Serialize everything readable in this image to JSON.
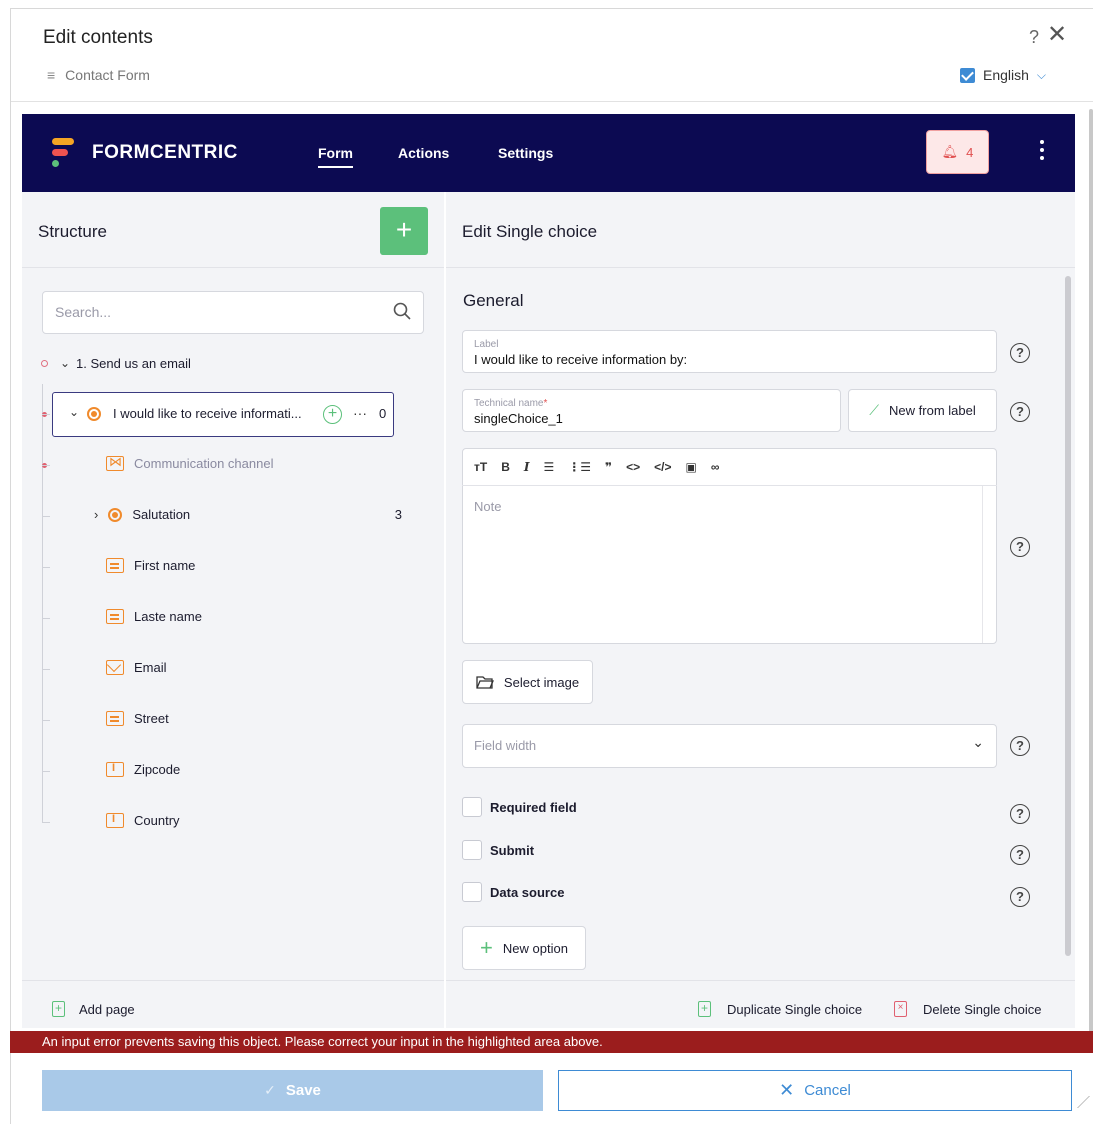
{
  "dialog": {
    "title": "Edit contents",
    "help_label": "?",
    "subtitle": "Contact Form",
    "language": "English"
  },
  "nav": {
    "brand": "FORMCENTRIC",
    "tabs": [
      "Form",
      "Actions",
      "Settings"
    ],
    "active_tab": "Form",
    "notification_count": "4",
    "colors": {
      "bar": "#0c0a52",
      "logo_top": "#f5a524",
      "logo_mid": "#ef5350",
      "logo_bot": "#5cc07b"
    }
  },
  "structure": {
    "title": "Structure",
    "search_placeholder": "Search...",
    "page": {
      "label": "1. Send us an email"
    },
    "selected": {
      "label": "I would like to receive informati...",
      "count": "0"
    },
    "items": [
      {
        "label": "Communication channel",
        "icon": "shuffle-icon"
      },
      {
        "label": "Salutation",
        "icon": "radio-icon",
        "count": "3"
      },
      {
        "label": "First name",
        "icon": "text-field-icon"
      },
      {
        "label": "Laste name",
        "icon": "text-field-icon"
      },
      {
        "label": "Email",
        "icon": "email-icon"
      },
      {
        "label": "Street",
        "icon": "text-field-icon"
      },
      {
        "label": "Zipcode",
        "icon": "number-field-icon"
      },
      {
        "label": "Country",
        "icon": "number-field-icon"
      }
    ],
    "add_page": "Add page"
  },
  "editor": {
    "title": "Edit Single choice",
    "section": "General",
    "label_field": {
      "label": "Label",
      "value": "I would like to receive information by:"
    },
    "tech_field": {
      "label": "Technical name",
      "required_mark": "*",
      "value": "singleChoice_1"
    },
    "new_from_label": "New from label",
    "toolbar": [
      "тT",
      "B",
      "I",
      "☰",
      "⋮☰",
      "❞",
      "<>",
      "</>",
      "▣",
      "∞"
    ],
    "note_placeholder": "Note",
    "select_image": "Select image",
    "field_width_placeholder": "Field width",
    "checkboxes": [
      "Required field",
      "Submit",
      "Data source"
    ],
    "new_option": "New option",
    "duplicate": "Duplicate Single choice",
    "delete": "Delete Single choice"
  },
  "error_message": "An input error prevents saving this object. Please correct your input in the highlighted area above.",
  "footer": {
    "save": "Save",
    "cancel": "Cancel"
  }
}
